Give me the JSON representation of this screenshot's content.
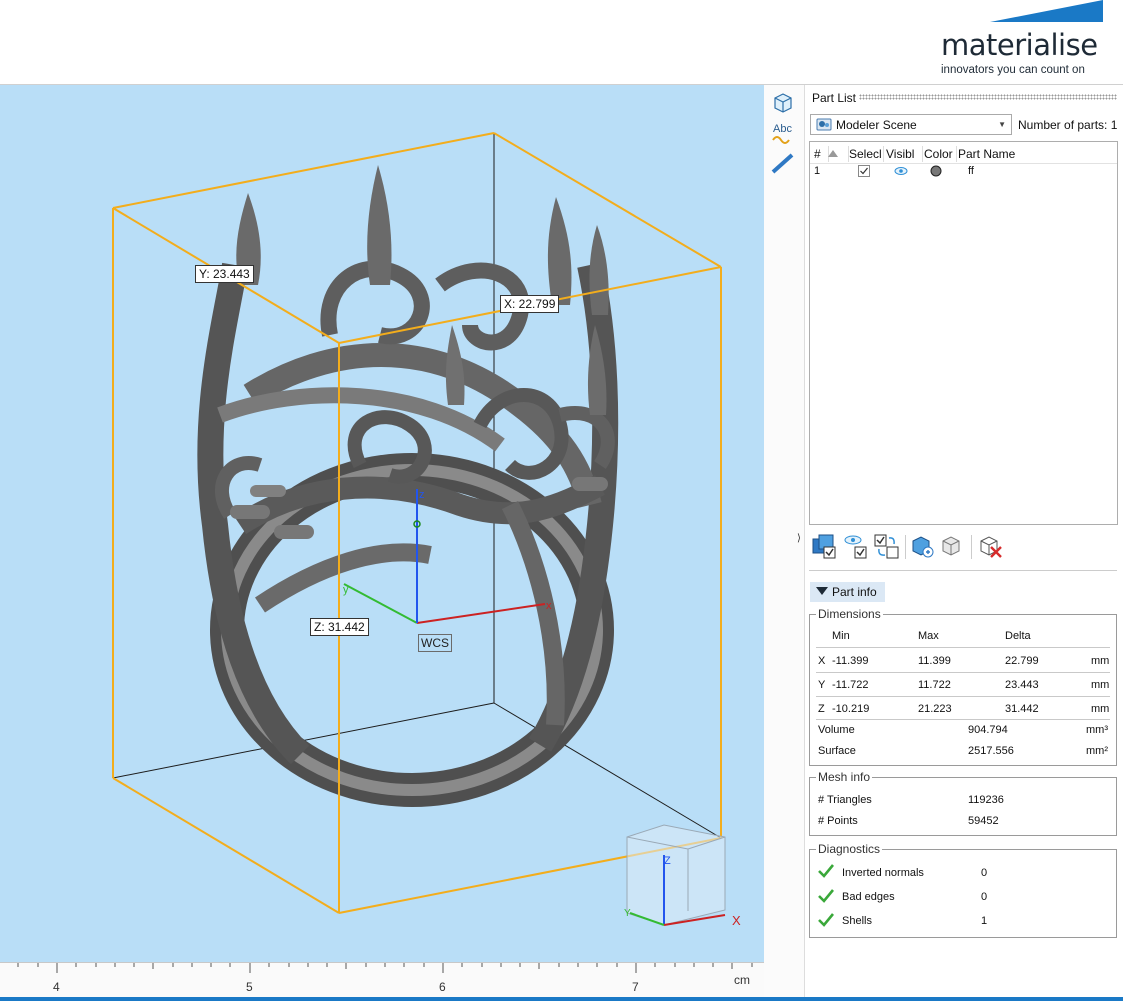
{
  "brand": {
    "name": "materialise",
    "tagline": "innovators you can count on",
    "accent_color": "#1a79c6"
  },
  "viewport": {
    "background": "#b9def7",
    "dim_labels": {
      "x": "X: 22.799",
      "y": "Y: 23.443",
      "z": "Z: 31.442"
    },
    "wcs_label": "WCS",
    "axis_letters": {
      "x": "x",
      "y": "y",
      "z": "z"
    },
    "navcube_letters": {
      "x": "X",
      "y": "Y",
      "z": "Z"
    },
    "ruler": {
      "ticks": [
        "4",
        "5",
        "6",
        "7"
      ],
      "unit": "cm"
    }
  },
  "toolstrip": {
    "tools": [
      "view-cube-icon",
      "text-annotation-icon",
      "measure-ruler-icon"
    ],
    "text_tool_label": "Abc"
  },
  "part_list": {
    "title": "Part List",
    "scene_select": "Modeler Scene",
    "parts_count_label": "Number of parts:",
    "parts_count": "1",
    "columns": [
      "#",
      "Select",
      "Visible",
      "Color",
      "Part Name"
    ],
    "columns_displayed": [
      "#",
      "Selecl",
      "Visibl",
      "Color",
      "Part Name"
    ],
    "rows": [
      {
        "num": "1",
        "selected": true,
        "visible": true,
        "color": "#777777",
        "name": "ff"
      }
    ],
    "actions": [
      "select-all-icon",
      "toggle-visibility-icon",
      "invert-selection-icon",
      "duplicate-part-icon",
      "wireframe-part-icon",
      "delete-part-icon"
    ]
  },
  "part_info": {
    "toggle_label": "Part info",
    "dimensions": {
      "legend": "Dimensions",
      "headers": [
        "Min",
        "Max",
        "Delta"
      ],
      "rows": [
        {
          "axis": "X",
          "min": "-11.399",
          "max": "11.399",
          "delta": "22.799",
          "unit": "mm"
        },
        {
          "axis": "Y",
          "min": "-11.722",
          "max": "11.722",
          "delta": "23.443",
          "unit": "mm"
        },
        {
          "axis": "Z",
          "min": "-10.219",
          "max": "21.223",
          "delta": "31.442",
          "unit": "mm"
        }
      ],
      "volume_label": "Volume",
      "volume": "904.794",
      "volume_unit": "mm³",
      "surface_label": "Surface",
      "surface": "2517.556",
      "surface_unit": "mm²"
    },
    "mesh": {
      "legend": "Mesh info",
      "triangles_label": "# Triangles",
      "triangles": "119236",
      "points_label": "# Points",
      "points": "59452"
    },
    "diagnostics": {
      "legend": "Diagnostics",
      "items": [
        {
          "label": "Inverted normals",
          "value": "0"
        },
        {
          "label": "Bad edges",
          "value": "0"
        },
        {
          "label": "Shells",
          "value": "1"
        }
      ],
      "ok_color": "#3aa83a"
    }
  }
}
